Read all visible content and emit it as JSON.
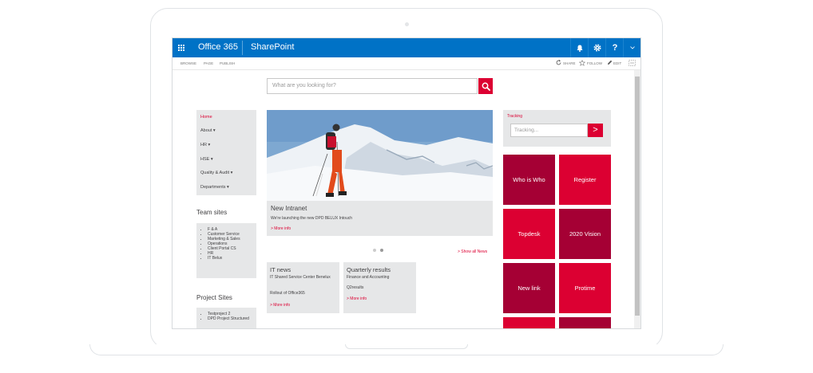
{
  "suite_bar": {
    "title": "Office 365",
    "app_name": "SharePoint",
    "notifications_icon": "bell-icon",
    "settings_icon": "gear-icon",
    "help_label": "?"
  },
  "ribbon": {
    "tabs": [
      "BROWSE",
      "PAGE",
      "PUBLISH"
    ],
    "actions": {
      "share": "SHARE",
      "follow": "FOLLOW",
      "edit": "EDIT"
    }
  },
  "search": {
    "placeholder": "What are you looking for?"
  },
  "nav": {
    "items": [
      {
        "label": "Home",
        "has_submenu": false,
        "active": true
      },
      {
        "label": "About",
        "has_submenu": true
      },
      {
        "label": "HR",
        "has_submenu": true
      },
      {
        "label": "HSE",
        "has_submenu": true
      },
      {
        "label": "Quality & Audit",
        "has_submenu": true
      },
      {
        "label": "Departments",
        "has_submenu": true
      }
    ]
  },
  "team_sites": {
    "heading": "Team sites",
    "items": [
      "F & A",
      "Customer Service",
      "Marketing & Sales",
      "Operations",
      "Client Portal CS",
      "HR",
      "IT Belux"
    ]
  },
  "project_sites": {
    "heading": "Project Sites",
    "items": [
      "Testproject 2",
      "DPD Project Structured"
    ]
  },
  "news": {
    "title": "New Intranet",
    "text": "We're launching the new DPD BELUX Intouch",
    "more": "> More info",
    "show_all": "> Show all News"
  },
  "cards": [
    {
      "heading": "IT news",
      "lines": [
        "IT Shared Service Center Benelux",
        "",
        "Rollout of Office365"
      ],
      "more": "> More info"
    },
    {
      "heading": "Quarterly results",
      "lines": [
        "Finance and Accounting",
        "",
        "Q2results"
      ],
      "more": "> More info"
    }
  ],
  "tracking": {
    "label": "Tracking",
    "placeholder": "Tracking...",
    "button": ">"
  },
  "tiles": [
    "Who is Who",
    "Register",
    "Topdesk",
    "2020 Vision",
    "New link",
    "Protime"
  ],
  "colors": {
    "suite_bar": "#0072c6",
    "accent_red": "#dc0032",
    "dark_red": "#a50034",
    "panel_grey": "#e6e7e8"
  }
}
